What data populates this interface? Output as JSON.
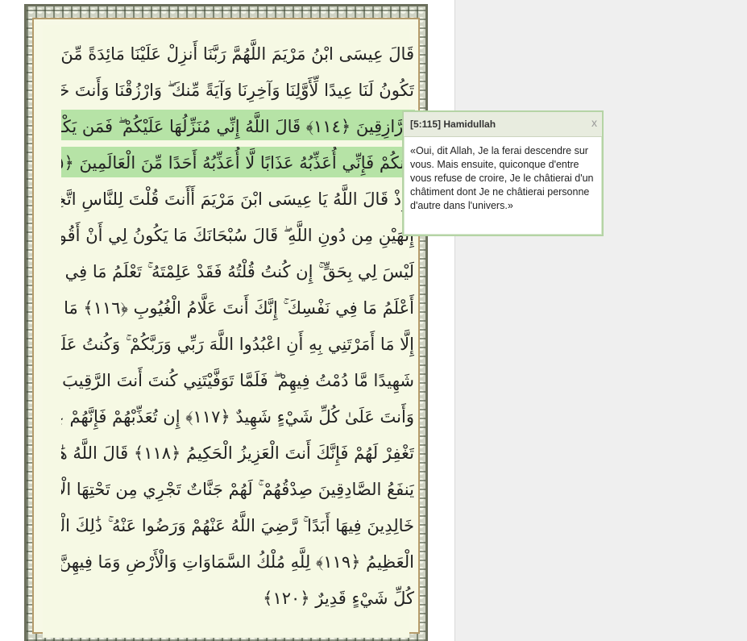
{
  "mushaf": {
    "lines": [
      "قَالَ عِيسَى ابْنُ مَرْيَمَ اللَّهُمَّ رَبَّنَا أَنزِلْ عَلَيْنَا مَائِدَةً مِّنَ السَّمَاءِ",
      "تَكُونُ لَنَا عِيدًا لِّأَوَّلِنَا وَآخِرِنَا وَآيَةً مِّنكَ ۖ وَارْزُقْنَا وَأَنتَ خَيْرُ",
      "الرَّازِقِينَ ﴿١١٤﴾ قَالَ اللَّهُ إِنِّي مُنَزِّلُهَا عَلَيْكُمْ ۖ فَمَن يَكْفُرْ بَعْدُ",
      "مِنكُمْ فَإِنِّي أُعَذِّبُهُ عَذَابًا لَّا أُعَذِّبُهُ أَحَدًا مِّنَ الْعَالَمِينَ ﴿١١٥﴾",
      "وَإِذْ قَالَ اللَّهُ يَا عِيسَى ابْنَ مَرْيَمَ أَأَنتَ قُلْتَ لِلنَّاسِ اتَّخِذُونِي وَأُمِّيَ",
      "إِلَٰهَيْنِ مِن دُونِ اللَّهِ ۖ قَالَ سُبْحَانَكَ مَا يَكُونُ لِي أَنْ أَقُولَ مَا",
      "لَيْسَ لِي بِحَقٍّ ۚ إِن كُنتُ قُلْتُهُ فَقَدْ عَلِمْتَهُ ۚ تَعْلَمُ مَا فِي نَفْسِي وَلَا",
      "أَعْلَمُ مَا فِي نَفْسِكَ ۚ إِنَّكَ أَنتَ عَلَّامُ الْغُيُوبِ ﴿١١٦﴾ مَا قُلْتُ لَهُمْ",
      "إِلَّا مَا أَمَرْتَنِي بِهِ أَنِ اعْبُدُوا اللَّهَ رَبِّي وَرَبَّكُمْ ۚ وَكُنتُ عَلَيْهِمْ",
      "شَهِيدًا مَّا دُمْتُ فِيهِمْ ۖ فَلَمَّا تَوَفَّيْتَنِي كُنتَ أَنتَ الرَّقِيبَ عَلَيْهِمْ ۚ",
      "وَأَنتَ عَلَىٰ كُلِّ شَيْءٍ شَهِيدٌ ﴿١١٧﴾ إِن تُعَذِّبْهُمْ فَإِنَّهُمْ عِبَادُكَ ۖ وَإِن",
      "تَغْفِرْ لَهُمْ فَإِنَّكَ أَنتَ الْعَزِيزُ الْحَكِيمُ ﴿١١٨﴾ قَالَ اللَّهُ هَٰذَا يَوْمُ",
      "يَنفَعُ الصَّادِقِينَ صِدْقُهُمْ ۚ لَهُمْ جَنَّاتٌ تَجْرِي مِن تَحْتِهَا الْأَنْهَارُ",
      "خَالِدِينَ فِيهَا أَبَدًا ۚ رَّضِيَ اللَّهُ عَنْهُمْ وَرَضُوا عَنْهُ ۚ ذَٰلِكَ الْفَوْزُ",
      "الْعَظِيمُ ﴿١١٩﴾ لِلَّهِ مُلْكُ السَّمَاوَاتِ وَالْأَرْضِ وَمَا فِيهِنَّ ۚ وَهُوَ عَلَىٰ",
      "كُلِّ شَيْءٍ قَدِيرٌ ﴿١٢٠﴾"
    ]
  },
  "tooltip": {
    "title": "[5:115] Hamidullah",
    "close_label": "x",
    "body": "«Oui, dit Allah, Je la ferai descendre sur vous. Mais ensuite, quiconque d'entre vous refuse de croire, Je le châtierai d'un châtiment dont Je ne châtierai personne d'autre dans l'univers.»"
  },
  "colors": {
    "highlight": "#b6e3a6",
    "page_background": "#f6f9e4",
    "frame_gold": "#b59b6b"
  }
}
